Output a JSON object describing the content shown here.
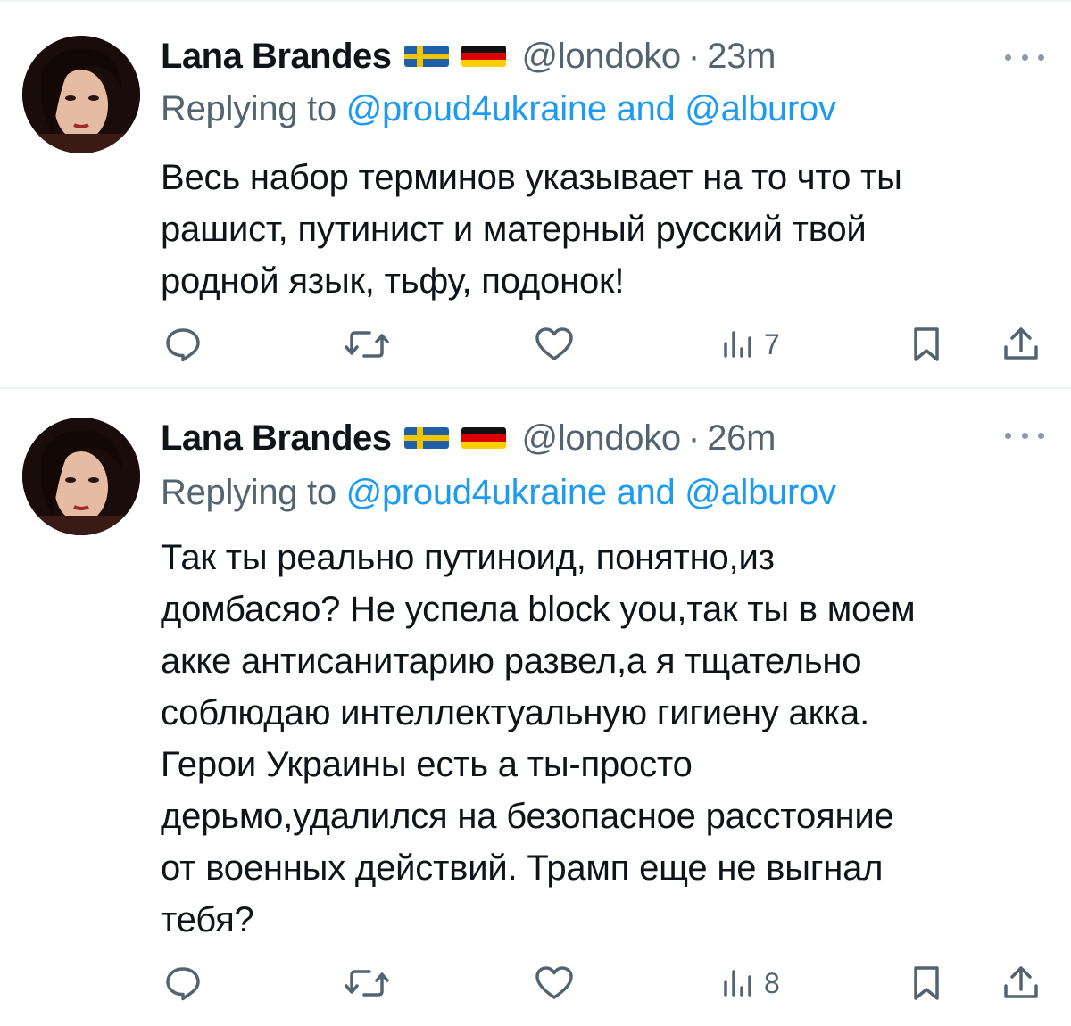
{
  "tweets": [
    {
      "author_name": "Lana Brandes",
      "flags": [
        "sweden-flag-icon",
        "germany-flag-icon"
      ],
      "handle": "@londoko",
      "separator": "·",
      "time": "23m",
      "replying_prefix": "Replying to ",
      "replying_to_1": "@proud4ukraine",
      "replying_and": " and ",
      "replying_to_2": "@alburov",
      "text_lines": [
        "Весь набор терминов указывает на то что ты",
        "рашист, путинист и матерный русский твой",
        "родной язык, тьфу, подонок!"
      ],
      "views": "7"
    },
    {
      "author_name": "Lana Brandes",
      "flags": [
        "sweden-flag-icon",
        "germany-flag-icon"
      ],
      "handle": "@londoko",
      "separator": "·",
      "time": "26m",
      "replying_prefix": "Replying to ",
      "replying_to_1": "@proud4ukraine",
      "replying_and": " and ",
      "replying_to_2": "@alburov",
      "text_lines": [
        "Так ты реально путиноид, понятно,из",
        "домбасяо? Не успела block you,так ты в моем",
        "акке антисанитарию развел,а я тщательно",
        "соблюдаю интеллектуальную гигиену акка.",
        "Герои Украины есть а ты-просто",
        "дерьмо,удалился на безопасное расстояние",
        "от военных действий. Трамп еще не выгнал",
        "тебя?"
      ],
      "views": "8"
    }
  ],
  "colors": {
    "text": "#0f1419",
    "secondary": "#536471",
    "link": "#1d9bf0",
    "divider": "#eff3f4"
  }
}
